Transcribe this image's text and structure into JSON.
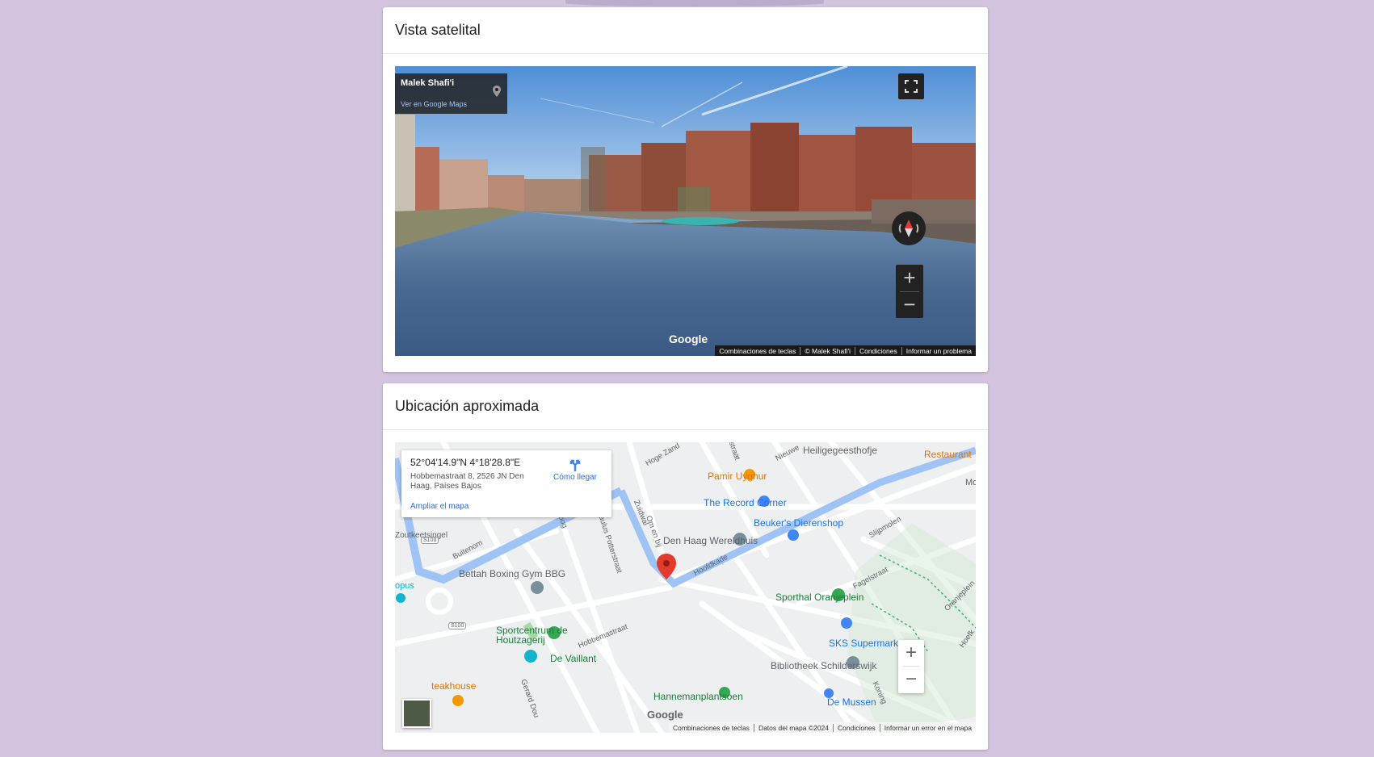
{
  "satellite_card": {
    "title": "Vista satelital",
    "streetview": {
      "author": "Malek Shafi'i",
      "open_link": "Ver en Google Maps",
      "google_logo": "Google",
      "footer": [
        "Combinaciones de teclas",
        "© Malek Shafi'i",
        "Condiciones",
        "Informar un problema"
      ]
    }
  },
  "location_card": {
    "title": "Ubicación aproximada",
    "info": {
      "coords": "52°04'14.9\"N 4°18'28.8\"E",
      "address": "Hobbemastraat 8, 2526 JN Den Haag, Países Bajos",
      "directions": "Cómo llegar",
      "enlarge": "Ampliar el mapa"
    },
    "pois": [
      "Heiligegeesthofje",
      "Restaurant",
      "Pamir Uyghur",
      "The Record Corner",
      "Beuker's Dierenshop",
      "Den Haag Wereldhuis",
      "Bettah Boxing Gym BBG",
      "Sporthal Oranjeplein",
      "Sportcentrum de Houtzagerij",
      "De Vaillant",
      "SKS Supermarkt",
      "Bibliotheek Schilderswijk",
      "teakhouse",
      "Hannemanplantsoen",
      "De Mussen",
      "Zoutkeetsingel",
      "opus",
      "Mo"
    ],
    "streets": [
      "Hoge Zand",
      "Nieuwe",
      "Zuidwal",
      "Om en bij",
      "Buitenom",
      "Paulus Potterstraat",
      "Hoofdkade",
      "Slijpmolen",
      "Fagelstraat",
      "Oranjeplein",
      "Hobbemastraat",
      "Gerard Dou",
      "Koning",
      "Hoefk",
      "S100",
      "S100",
      "Hoog",
      "straat"
    ],
    "google_logo": "Google",
    "footer": [
      "Combinaciones de teclas",
      "Datos del mapa ©2024",
      "Condiciones",
      "Informar un error en el mapa"
    ]
  }
}
